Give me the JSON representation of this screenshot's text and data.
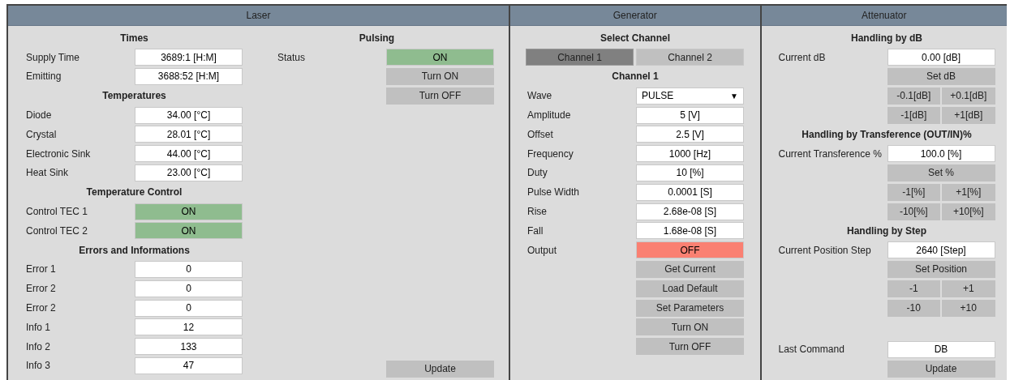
{
  "laser": {
    "title": "Laser",
    "sections": [
      {
        "heading": "Times",
        "rows": [
          {
            "kind": "field",
            "label": "Supply Time",
            "value": "3689:1 [H:M]"
          },
          {
            "kind": "field",
            "label": "Emitting",
            "value": "3688:52 [H:M]"
          }
        ]
      },
      {
        "heading": "Temperatures",
        "rows": [
          {
            "kind": "field",
            "label": "Diode",
            "value": "34.00 [°C]"
          },
          {
            "kind": "field",
            "label": "Crystal",
            "value": "28.01 [°C]"
          },
          {
            "kind": "field",
            "label": "Electronic Sink",
            "value": "44.00 [°C]"
          },
          {
            "kind": "field",
            "label": "Heat Sink",
            "value": "23.00 [°C]"
          }
        ]
      },
      {
        "heading": "Temperature Control",
        "rows": [
          {
            "kind": "status",
            "label": "Control TEC 1",
            "value": "ON",
            "on": true
          },
          {
            "kind": "status",
            "label": "Control TEC 2",
            "value": "ON",
            "on": true
          }
        ]
      },
      {
        "heading": "Errors and Informations",
        "rows": [
          {
            "kind": "field",
            "label": "Error 1",
            "value": "0"
          },
          {
            "kind": "field",
            "label": "Error 2",
            "value": "0"
          },
          {
            "kind": "field",
            "label": "Error 2",
            "value": "0"
          },
          {
            "kind": "field",
            "label": "Info 1",
            "value": "12"
          },
          {
            "kind": "field",
            "label": "Info 2",
            "value": "133"
          },
          {
            "kind": "field",
            "label": "Info 3",
            "value": "47"
          }
        ]
      }
    ],
    "pulsing": {
      "heading": "Pulsing",
      "rows": [
        {
          "kind": "status",
          "label": "Status",
          "value": "ON",
          "on": true
        },
        {
          "kind": "button",
          "label": "Turn ON"
        },
        {
          "kind": "button",
          "label": "Turn OFF"
        }
      ],
      "update": "Update"
    }
  },
  "generator": {
    "title": "Generator",
    "select_heading": "Select Channel",
    "channel_tabs": [
      {
        "label": "Channel 1",
        "selected": true
      },
      {
        "label": "Channel 2",
        "selected": false
      }
    ],
    "channel_heading": "Channel 1",
    "rows": [
      {
        "kind": "select",
        "label": "Wave",
        "value": "PULSE",
        "arrow": "▼"
      },
      {
        "kind": "field",
        "label": "Amplitude",
        "value": "5 [V]"
      },
      {
        "kind": "field",
        "label": "Offset",
        "value": "2.5 [V]"
      },
      {
        "kind": "field",
        "label": "Frequency",
        "value": "1000 [Hz]"
      },
      {
        "kind": "field",
        "label": "Duty",
        "value": "10 [%]"
      },
      {
        "kind": "field",
        "label": "Pulse Width",
        "value": "0.0001 [S]"
      },
      {
        "kind": "field",
        "label": "Rise",
        "value": "2.68e-08 [S]"
      },
      {
        "kind": "field",
        "label": "Fall",
        "value": "1.68e-08 [S]"
      },
      {
        "kind": "status",
        "label": "Output",
        "value": "OFF",
        "on": false
      },
      {
        "kind": "button",
        "label": "Get Current"
      },
      {
        "kind": "button",
        "label": "Load Default"
      },
      {
        "kind": "button",
        "label": "Set Parameters"
      },
      {
        "kind": "button",
        "label": "Turn ON"
      },
      {
        "kind": "button",
        "label": "Turn OFF"
      }
    ]
  },
  "attenuator": {
    "title": "Attenuator",
    "sections": [
      {
        "heading": "Handling by dB",
        "rows": [
          {
            "kind": "field",
            "label": "Current dB",
            "value": "0.00 [dB]"
          },
          {
            "kind": "button",
            "label": "Set dB"
          },
          {
            "kind": "pair",
            "buttons": [
              "-0.1[dB]",
              "+0.1[dB]"
            ]
          },
          {
            "kind": "pair",
            "buttons": [
              "-1[dB]",
              "+1[dB]"
            ]
          }
        ]
      },
      {
        "heading": "Handling by Transference (OUT/IN)%",
        "rows": [
          {
            "kind": "field",
            "label": "Current Transference %",
            "value": "100.0 [%]"
          },
          {
            "kind": "button",
            "label": "Set %"
          },
          {
            "kind": "pair",
            "buttons": [
              "-1[%]",
              "+1[%]"
            ]
          },
          {
            "kind": "pair",
            "buttons": [
              "-10[%]",
              "+10[%]"
            ]
          }
        ]
      },
      {
        "heading": "Handling by Step",
        "rows": [
          {
            "kind": "field",
            "label": "Current Position Step",
            "value": "2640 [Step]"
          },
          {
            "kind": "button",
            "label": "Set Position"
          },
          {
            "kind": "pair",
            "buttons": [
              "-1",
              "+1"
            ]
          },
          {
            "kind": "pair",
            "buttons": [
              "-10",
              "+10"
            ]
          }
        ]
      }
    ],
    "last_command": {
      "label": "Last Command",
      "value": "DB"
    },
    "update": "Update"
  }
}
